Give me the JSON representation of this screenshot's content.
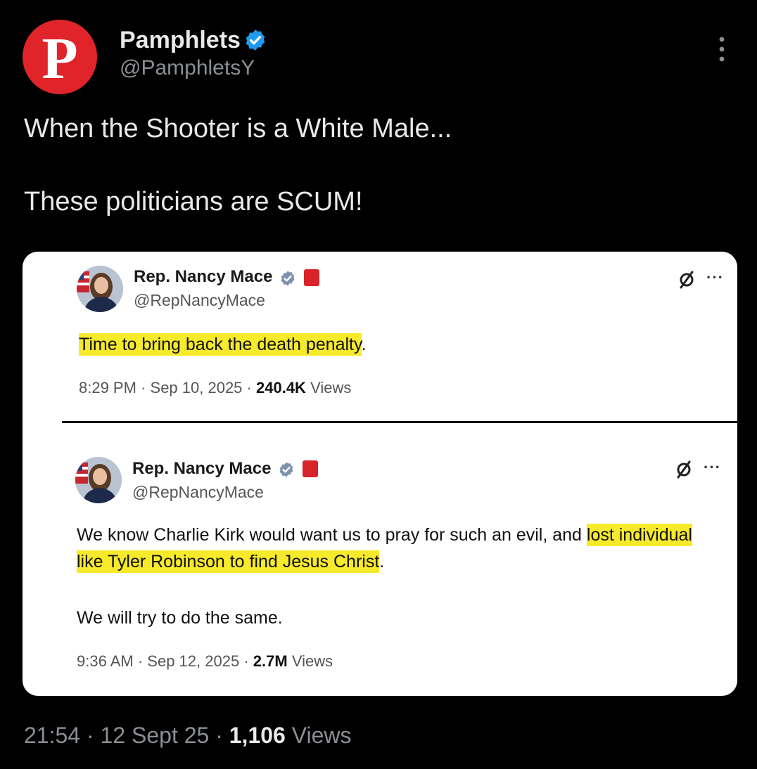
{
  "post": {
    "author": {
      "avatar_letter": "P",
      "name": "Pamphlets",
      "handle": "@PamphletsY",
      "verified_icon": "verified-badge-icon"
    },
    "text_lines": [
      "When the Shooter is a White Male...",
      "These politicians are SCUM!"
    ],
    "meta": {
      "time": "21:54",
      "date": "12 Sept 25",
      "views_count": "1,106",
      "views_label": "Views",
      "separator": "·"
    }
  },
  "screenshot_card": {
    "tweets": [
      {
        "name": "Rep. Nancy Mace",
        "handle": "@RepNancyMace",
        "more": "···",
        "text_plain_before": "",
        "text_highlight": "Time to bring back the death penalty",
        "text_plain_after": ".",
        "time": "8:29 PM",
        "date": "Sep 10, 2025",
        "views_count": "240.4K",
        "views_label": "Views"
      },
      {
        "name": "Rep. Nancy Mace",
        "handle": "@RepNancyMace",
        "more": "···",
        "text_plain_before": "We know Charlie Kirk would want us to pray for such an evil, and ",
        "text_highlight": "lost individual like Tyler Robinson to find Jesus Christ",
        "text_plain_after": ".",
        "text_second_paragraph": "We will try to do the same.",
        "time": "9:36 AM",
        "date": "Sep 12, 2025",
        "views_count": "2.7M",
        "views_label": "Views"
      }
    ]
  },
  "colors": {
    "background": "#000000",
    "avatar_red": "#e0242a",
    "verified_blue": "#1d9bf0",
    "highlight_yellow": "#f6ea2a",
    "muted_text": "#8b8f94"
  }
}
